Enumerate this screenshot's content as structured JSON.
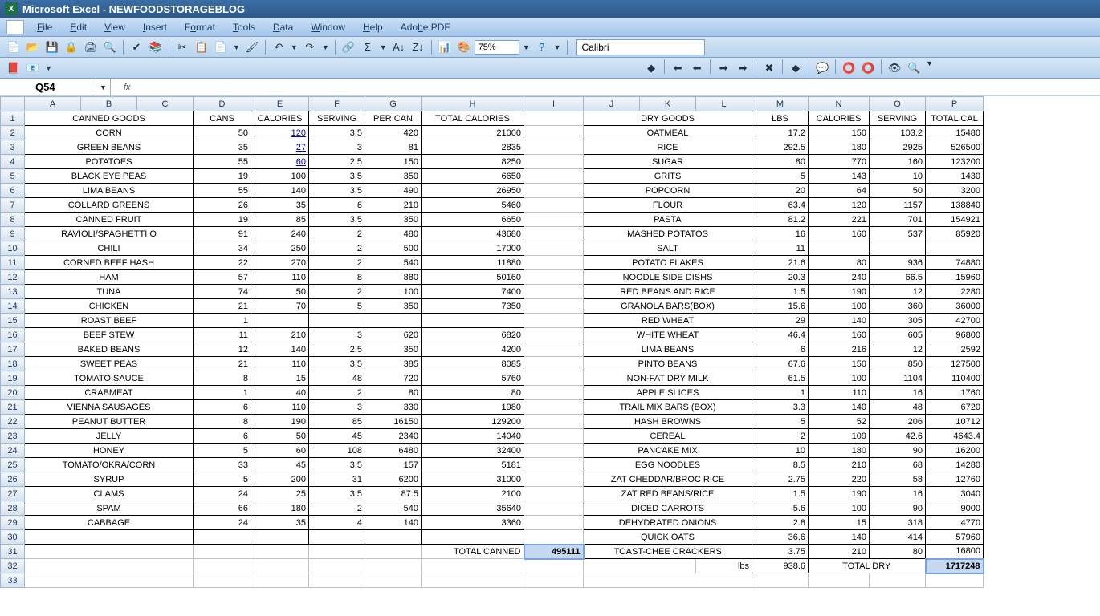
{
  "app": {
    "title": "Microsoft Excel - NEWFOODSTORAGEBLOG"
  },
  "menu": {
    "file": "File",
    "edit": "Edit",
    "view": "View",
    "insert": "Insert",
    "format": "Format",
    "tools": "Tools",
    "data": "Data",
    "window": "Window",
    "help": "Help",
    "pdf": "Adobe PDF"
  },
  "toolbar": {
    "zoom": "75%",
    "font": "Calibri"
  },
  "formula": {
    "cell": "Q54",
    "fx": "fx"
  },
  "columns": [
    "A",
    "B",
    "C",
    "D",
    "E",
    "F",
    "G",
    "H",
    "I",
    "J",
    "K",
    "L",
    "M",
    "N",
    "O",
    "P"
  ],
  "headers1": {
    "canned": "CANNED GOODS",
    "cans": "CANS",
    "cal": "CALORIES",
    "serv": "SERVING",
    "percan": "PER CAN",
    "totcal": "TOTAL CALORIES",
    "dry": "DRY GOODS",
    "lbs": "LBS",
    "cal2": "CALORIES",
    "serv2": "SERVING",
    "totcal2": "TOTAL CAL"
  },
  "canned_rows": [
    {
      "r": 2,
      "name": "CORN",
      "cans": "50",
      "cal": "120",
      "link": true,
      "serv": "3.5",
      "per": "420",
      "tot": "21000"
    },
    {
      "r": 3,
      "name": "GREEN BEANS",
      "cans": "35",
      "cal": "27",
      "link": true,
      "serv": "3",
      "per": "81",
      "tot": "2835"
    },
    {
      "r": 4,
      "name": "POTATOES",
      "cans": "55",
      "cal": "60",
      "link": true,
      "serv": "2.5",
      "per": "150",
      "tot": "8250"
    },
    {
      "r": 5,
      "name": "BLACK EYE PEAS",
      "cans": "19",
      "cal": "100",
      "serv": "3.5",
      "per": "350",
      "tot": "6650"
    },
    {
      "r": 6,
      "name": "LIMA BEANS",
      "cans": "55",
      "cal": "140",
      "serv": "3.5",
      "per": "490",
      "tot": "26950"
    },
    {
      "r": 7,
      "name": "COLLARD GREENS",
      "cans": "26",
      "cal": "35",
      "serv": "6",
      "per": "210",
      "tot": "5460"
    },
    {
      "r": 8,
      "name": "CANNED FRUIT",
      "cans": "19",
      "cal": "85",
      "serv": "3.5",
      "per": "350",
      "tot": "6650"
    },
    {
      "r": 9,
      "name": "RAVIOLI/SPAGHETTI O",
      "cans": "91",
      "cal": "240",
      "serv": "2",
      "per": "480",
      "tot": "43680"
    },
    {
      "r": 10,
      "name": "CHILI",
      "cans": "34",
      "cal": "250",
      "serv": "2",
      "per": "500",
      "tot": "17000"
    },
    {
      "r": 11,
      "name": "CORNED BEEF HASH",
      "cans": "22",
      "cal": "270",
      "serv": "2",
      "per": "540",
      "tot": "11880"
    },
    {
      "r": 12,
      "name": "HAM",
      "cans": "57",
      "cal": "110",
      "serv": "8",
      "per": "880",
      "tot": "50160"
    },
    {
      "r": 13,
      "name": "TUNA",
      "cans": "74",
      "cal": "50",
      "serv": "2",
      "per": "100",
      "tot": "7400"
    },
    {
      "r": 14,
      "name": "CHICKEN",
      "cans": "21",
      "cal": "70",
      "serv": "5",
      "per": "350",
      "tot": "7350"
    },
    {
      "r": 15,
      "name": "ROAST BEEF",
      "cans": "1",
      "cal": "",
      "serv": "",
      "per": "",
      "tot": ""
    },
    {
      "r": 16,
      "name": "BEEF STEW",
      "cans": "11",
      "cal": "210",
      "serv": "3",
      "per": "620",
      "tot": "6820"
    },
    {
      "r": 17,
      "name": "BAKED BEANS",
      "cans": "12",
      "cal": "140",
      "serv": "2.5",
      "per": "350",
      "tot": "4200"
    },
    {
      "r": 18,
      "name": "SWEET PEAS",
      "cans": "21",
      "cal": "110",
      "serv": "3.5",
      "per": "385",
      "tot": "8085"
    },
    {
      "r": 19,
      "name": "TOMATO SAUCE",
      "cans": "8",
      "cal": "15",
      "serv": "48",
      "per": "720",
      "tot": "5760"
    },
    {
      "r": 20,
      "name": "CRABMEAT",
      "cans": "1",
      "cal": "40",
      "serv": "2",
      "per": "80",
      "tot": "80"
    },
    {
      "r": 21,
      "name": "VIENNA SAUSAGES",
      "cans": "6",
      "cal": "110",
      "serv": "3",
      "per": "330",
      "tot": "1980"
    },
    {
      "r": 22,
      "name": "PEANUT BUTTER",
      "cans": "8",
      "cal": "190",
      "serv": "85",
      "per": "16150",
      "tot": "129200"
    },
    {
      "r": 23,
      "name": "JELLY",
      "cans": "6",
      "cal": "50",
      "serv": "45",
      "per": "2340",
      "tot": "14040"
    },
    {
      "r": 24,
      "name": "HONEY",
      "cans": "5",
      "cal": "60",
      "serv": "108",
      "per": "6480",
      "tot": "32400"
    },
    {
      "r": 25,
      "name": "TOMATO/OKRA/CORN",
      "cans": "33",
      "cal": "45",
      "serv": "3.5",
      "per": "157",
      "tot": "5181"
    },
    {
      "r": 26,
      "name": "SYRUP",
      "cans": "5",
      "cal": "200",
      "serv": "31",
      "per": "6200",
      "tot": "31000"
    },
    {
      "r": 27,
      "name": "CLAMS",
      "cans": "24",
      "cal": "25",
      "serv": "3.5",
      "per": "87.5",
      "tot": "2100"
    },
    {
      "r": 28,
      "name": "SPAM",
      "cans": "66",
      "cal": "180",
      "serv": "2",
      "per": "540",
      "tot": "35640"
    },
    {
      "r": 29,
      "name": "CABBAGE",
      "cans": "24",
      "cal": "35",
      "serv": "4",
      "per": "140",
      "tot": "3360"
    }
  ],
  "dry_rows": [
    {
      "r": 2,
      "name": "OATMEAL",
      "lbs": "17.2",
      "cal": "150",
      "serv": "103.2",
      "tot": "15480"
    },
    {
      "r": 3,
      "name": "RICE",
      "lbs": "292.5",
      "cal": "180",
      "serv": "2925",
      "tot": "526500"
    },
    {
      "r": 4,
      "name": "SUGAR",
      "lbs": "80",
      "cal": "770",
      "serv": "160",
      "tot": "123200"
    },
    {
      "r": 5,
      "name": "GRITS",
      "lbs": "5",
      "cal": "143",
      "serv": "10",
      "tot": "1430"
    },
    {
      "r": 6,
      "name": "POPCORN",
      "lbs": "20",
      "cal": "64",
      "serv": "50",
      "tot": "3200"
    },
    {
      "r": 7,
      "name": "FLOUR",
      "lbs": "63.4",
      "cal": "120",
      "serv": "1157",
      "tot": "138840"
    },
    {
      "r": 8,
      "name": "PASTA",
      "lbs": "81.2",
      "cal": "221",
      "serv": "701",
      "tot": "154921"
    },
    {
      "r": 9,
      "name": "MASHED POTATOS",
      "lbs": "16",
      "cal": "160",
      "serv": "537",
      "tot": "85920"
    },
    {
      "r": 10,
      "name": "SALT",
      "lbs": "11",
      "cal": "",
      "serv": "",
      "tot": ""
    },
    {
      "r": 11,
      "name": "POTATO FLAKES",
      "lbs": "21.6",
      "cal": "80",
      "serv": "936",
      "tot": "74880"
    },
    {
      "r": 12,
      "name": "NOODLE SIDE DISHS",
      "lbs": "20.3",
      "cal": "240",
      "serv": "66.5",
      "tot": "15960"
    },
    {
      "r": 13,
      "name": "RED BEANS AND RICE",
      "lbs": "1.5",
      "cal": "190",
      "serv": "12",
      "tot": "2280"
    },
    {
      "r": 14,
      "name": "GRANOLA BARS(BOX)",
      "lbs": "15.6",
      "cal": "100",
      "serv": "360",
      "tot": "36000"
    },
    {
      "r": 15,
      "name": "RED WHEAT",
      "lbs": "29",
      "cal": "140",
      "serv": "305",
      "tot": "42700"
    },
    {
      "r": 16,
      "name": "WHITE WHEAT",
      "lbs": "46.4",
      "cal": "160",
      "serv": "605",
      "tot": "96800"
    },
    {
      "r": 17,
      "name": "LIMA BEANS",
      "lbs": "6",
      "cal": "216",
      "serv": "12",
      "tot": "2592"
    },
    {
      "r": 18,
      "name": "PINTO BEANS",
      "lbs": "67.6",
      "cal": "150",
      "serv": "850",
      "tot": "127500"
    },
    {
      "r": 19,
      "name": "NON-FAT DRY MILK",
      "lbs": "61.5",
      "cal": "100",
      "serv": "1104",
      "tot": "110400"
    },
    {
      "r": 20,
      "name": "APPLE SLICES",
      "lbs": "1",
      "cal": "110",
      "serv": "16",
      "tot": "1760"
    },
    {
      "r": 21,
      "name": "TRAIL MIX BARS (BOX)",
      "lbs": "3.3",
      "cal": "140",
      "serv": "48",
      "tot": "6720"
    },
    {
      "r": 22,
      "name": "HASH BROWNS",
      "lbs": "5",
      "cal": "52",
      "serv": "206",
      "tot": "10712"
    },
    {
      "r": 23,
      "name": "CEREAL",
      "lbs": "2",
      "cal": "109",
      "serv": "42.6",
      "tot": "4643.4"
    },
    {
      "r": 24,
      "name": "PANCAKE MIX",
      "lbs": "10",
      "cal": "180",
      "serv": "90",
      "tot": "16200"
    },
    {
      "r": 25,
      "name": "EGG NOODLES",
      "lbs": "8.5",
      "cal": "210",
      "serv": "68",
      "tot": "14280"
    },
    {
      "r": 26,
      "name": "ZAT CHEDDAR/BROC RICE",
      "lbs": "2.75",
      "cal": "220",
      "serv": "58",
      "tot": "12760"
    },
    {
      "r": 27,
      "name": "ZAT RED BEANS/RICE",
      "lbs": "1.5",
      "cal": "190",
      "serv": "16",
      "tot": "3040"
    },
    {
      "r": 28,
      "name": "DICED CARROTS",
      "lbs": "5.6",
      "cal": "100",
      "serv": "90",
      "tot": "9000"
    },
    {
      "r": 29,
      "name": "DEHYDRATED ONIONS",
      "lbs": "2.8",
      "cal": "15",
      "serv": "318",
      "tot": "4770"
    },
    {
      "r": 30,
      "name": "QUICK OATS",
      "lbs": "36.6",
      "cal": "140",
      "serv": "414",
      "tot": "57960"
    },
    {
      "r": 31,
      "name": "TOAST-CHEE CRACKERS",
      "lbs": "3.75",
      "cal": "210",
      "serv": "80",
      "tot": "16800"
    }
  ],
  "totals": {
    "canned_label": "TOTAL CANNED",
    "canned_val": "495111",
    "lbs_label": "lbs",
    "lbs_val": "938.6",
    "dry_label": "TOTAL DRY",
    "dry_val": "1717248"
  }
}
